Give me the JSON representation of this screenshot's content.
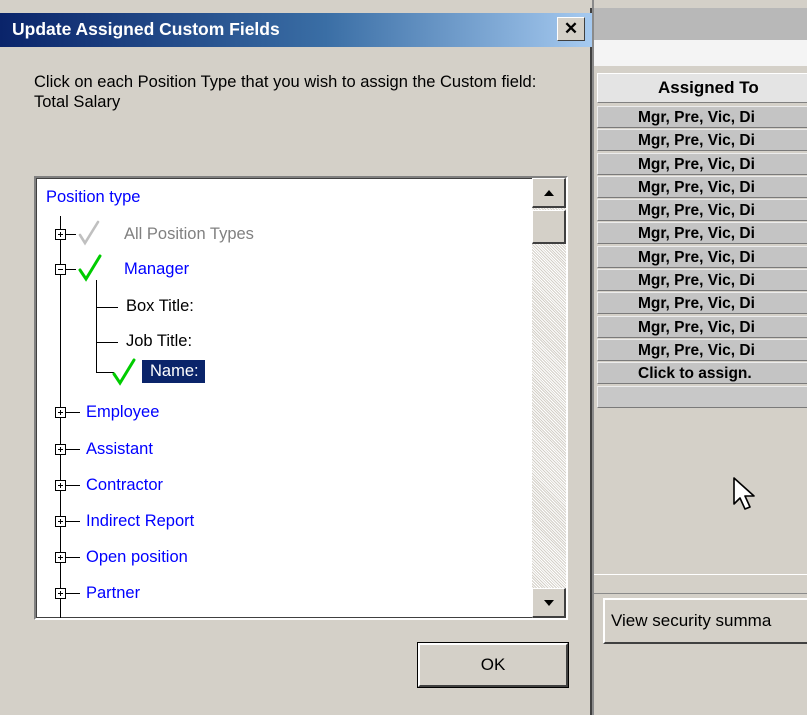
{
  "dialog": {
    "title": "Update Assigned Custom Fields",
    "close_glyph": "✕",
    "instructions": "Click on each Position Type that you wish to assign the Custom field: Total Salary",
    "ok_label": "OK"
  },
  "tree": {
    "root_label": "Position type",
    "items": [
      {
        "label": "All Position Types",
        "checked": true,
        "check_color": "#c0c0c0",
        "expanded": false
      },
      {
        "label": "Manager",
        "checked": true,
        "check_color": "#00cc00",
        "expanded": true,
        "children": [
          {
            "label": "Box Title:"
          },
          {
            "label": "Job Title:"
          },
          {
            "label": "Name:",
            "checked": true,
            "selected": true
          }
        ]
      },
      {
        "label": "Employee"
      },
      {
        "label": "Assistant"
      },
      {
        "label": "Contractor"
      },
      {
        "label": "Indirect Report"
      },
      {
        "label": "Open position"
      },
      {
        "label": "Partner"
      }
    ]
  },
  "background_table": {
    "header": "Assigned To",
    "rows": [
      "Mgr, Pre, Vic, Di",
      "Mgr, Pre, Vic, Di",
      "Mgr, Pre, Vic, Di",
      "Mgr, Pre, Vic, Di",
      "Mgr, Pre, Vic, Di",
      "Mgr, Pre, Vic, Di",
      "Mgr, Pre, Vic, Di",
      "Mgr, Pre, Vic, Di",
      "Mgr, Pre, Vic, Di",
      "Mgr, Pre, Vic, Di",
      "Mgr, Pre, Vic, Di",
      "Click to assign.",
      ""
    ],
    "security_button_label": "View security summa"
  },
  "colors": {
    "title_start": "#0a246a",
    "title_end": "#a6caf0",
    "tree_link": "#0000ff",
    "selection": "#0a246a",
    "check_active": "#00cc00",
    "check_inactive": "#c0c0c0"
  }
}
